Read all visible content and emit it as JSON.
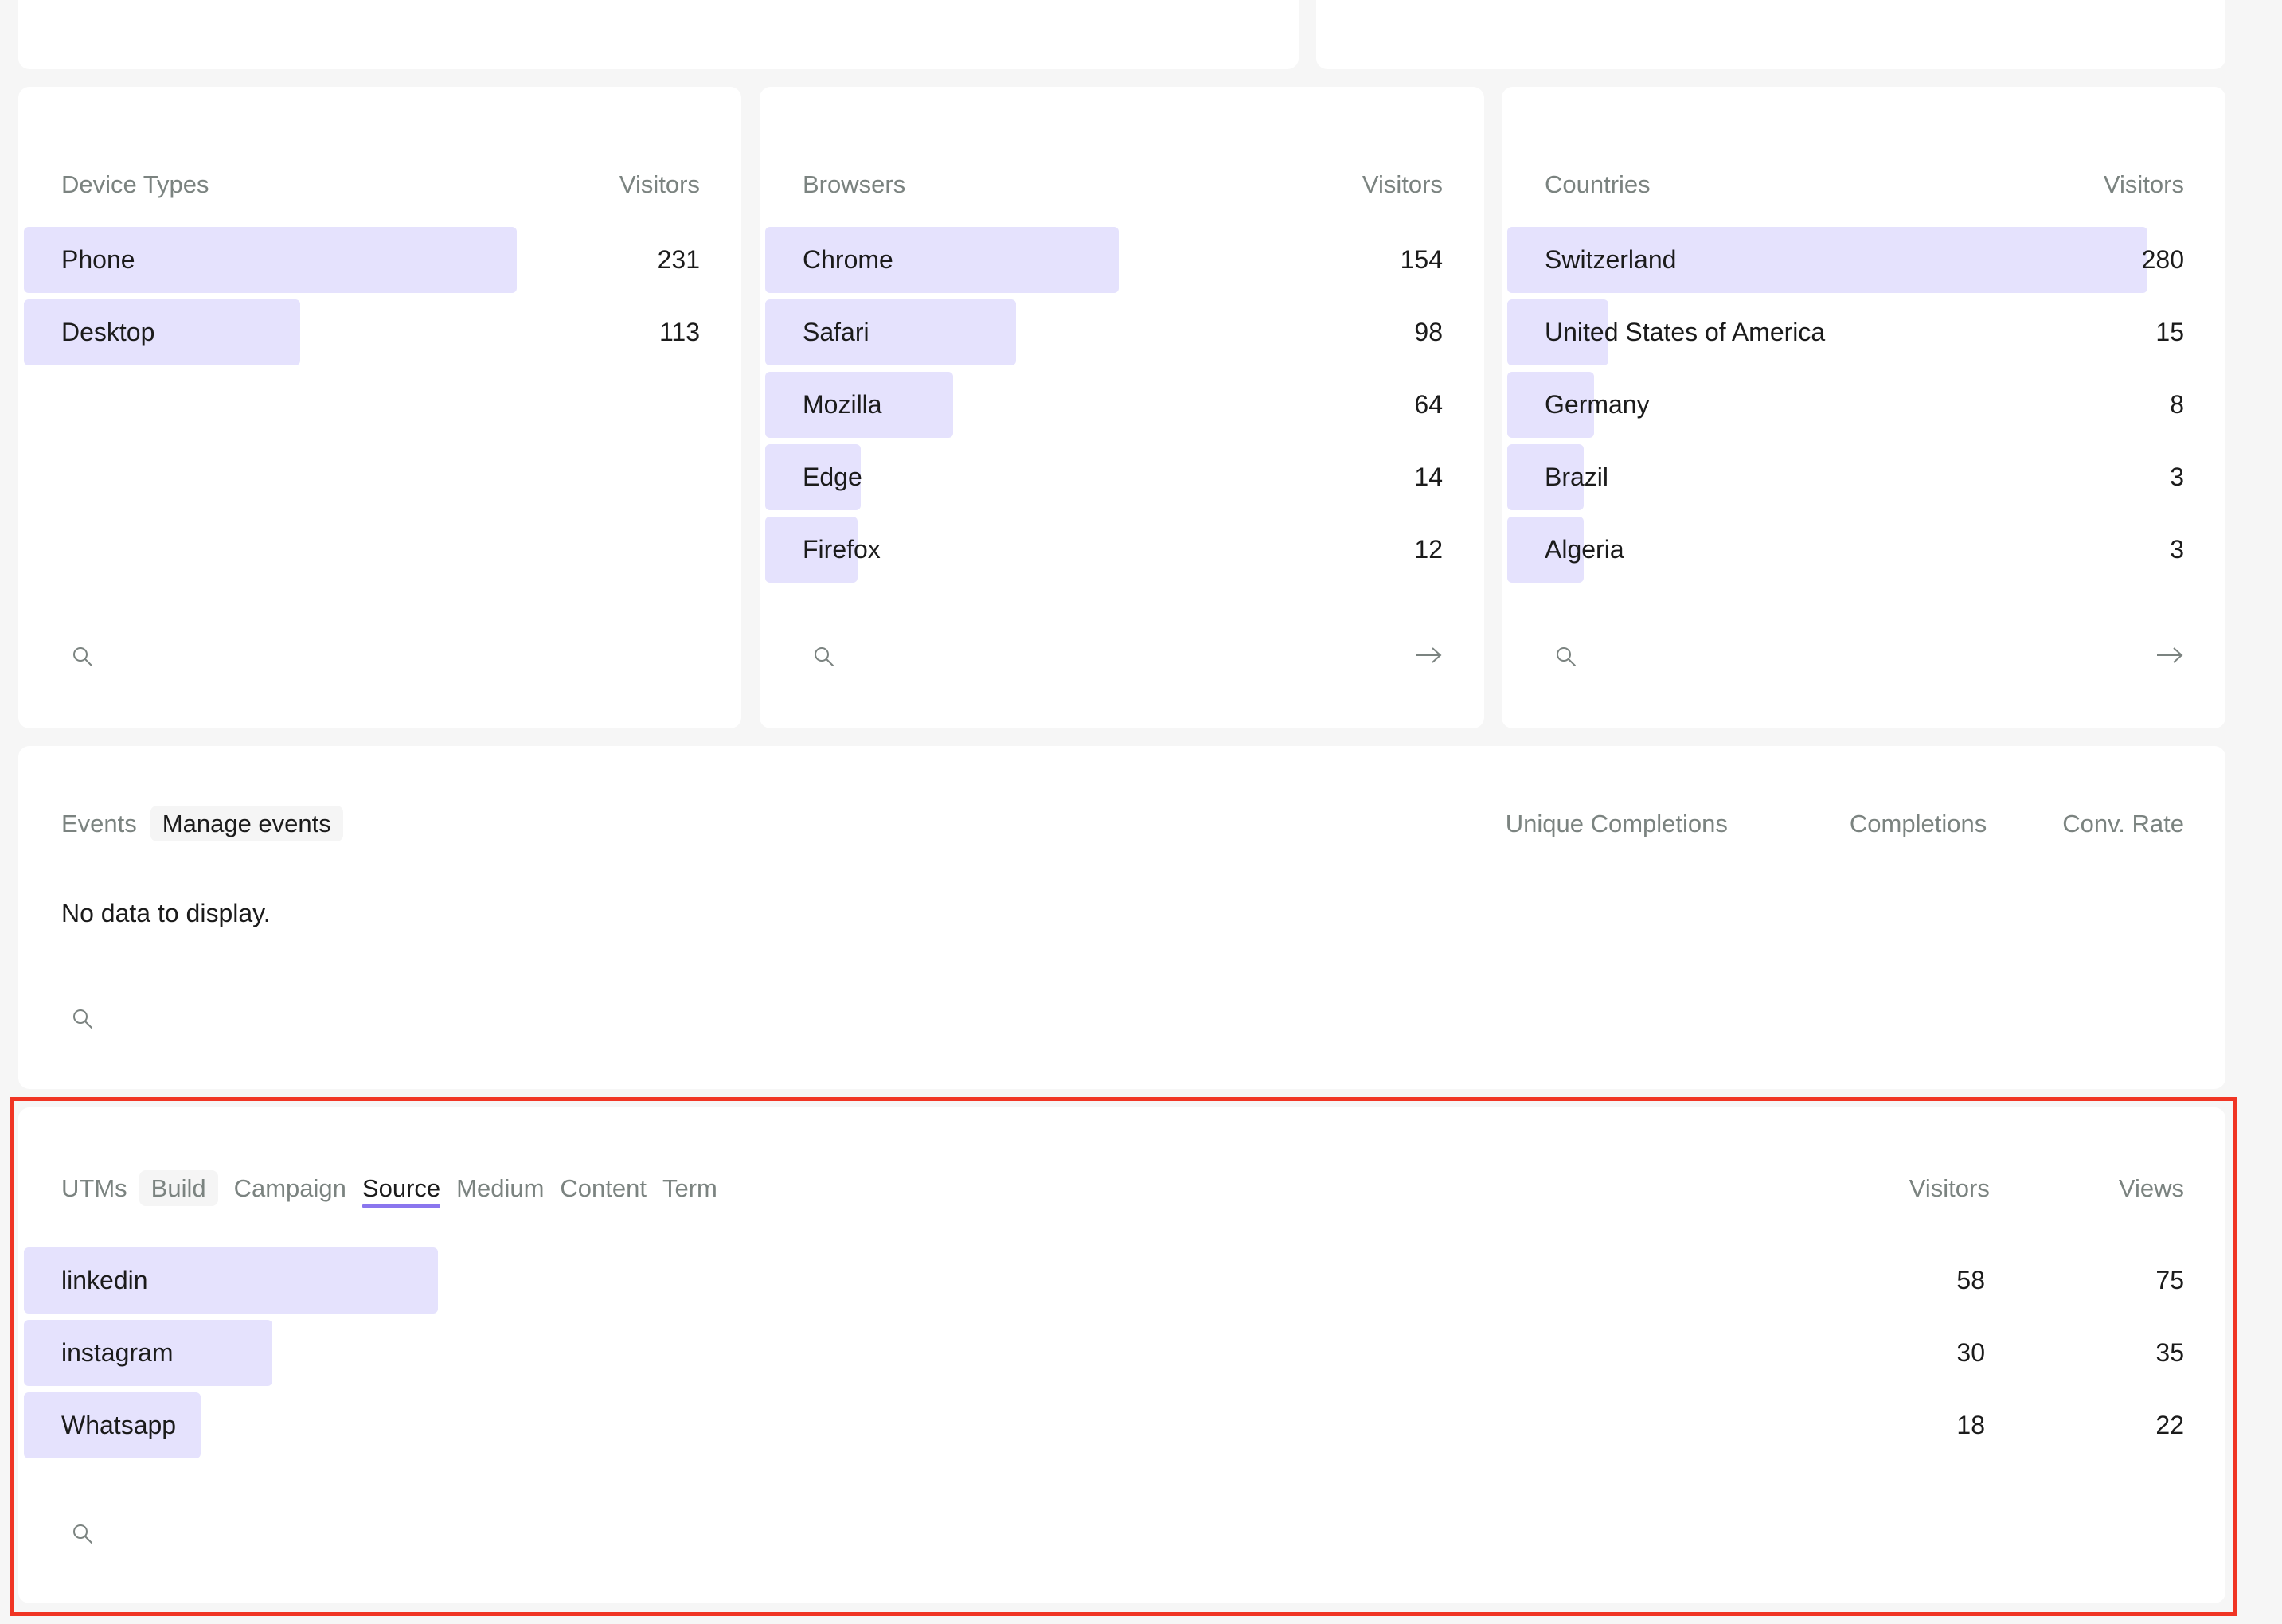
{
  "colors": {
    "background": "#f6f6f6",
    "card": "#ffffff",
    "bar": "#e5e2fd",
    "muted_text": "#7b8380",
    "text": "#1b1b1b",
    "active_tab_underline": "#8a76ee",
    "highlight_box": "#f03524"
  },
  "top_cards": {
    "left": {
      "icons": [
        "search-icon",
        "arrow-right-icon"
      ]
    },
    "right": {
      "icons": [
        "search-icon"
      ]
    }
  },
  "device_types": {
    "title": "Device Types",
    "metric_label": "Visitors",
    "rows": [
      {
        "label": "Phone",
        "value": "231",
        "share": 67.2
      },
      {
        "label": "Desktop",
        "value": "113",
        "share": 32.8
      }
    ],
    "footer_icons": [
      "search-icon"
    ]
  },
  "browsers": {
    "title": "Browsers",
    "metric_label": "Visitors",
    "rows": [
      {
        "label": "Chrome",
        "value": "154",
        "share": 45.0
      },
      {
        "label": "Safari",
        "value": "98",
        "share": 28.7
      },
      {
        "label": "Mozilla",
        "value": "64",
        "share": 18.7
      },
      {
        "label": "Edge",
        "value": "14",
        "share": 4.1
      },
      {
        "label": "Firefox",
        "value": "12",
        "share": 3.5
      }
    ],
    "footer_icons": [
      "search-icon",
      "arrow-right-icon"
    ]
  },
  "countries": {
    "title": "Countries",
    "metric_label": "Visitors",
    "rows": [
      {
        "label": "Switzerland",
        "value": "280",
        "share": 90.6
      },
      {
        "label": "United States of America",
        "value": "15",
        "share": 4.9
      },
      {
        "label": "Germany",
        "value": "8",
        "share": 2.6
      },
      {
        "label": "Brazil",
        "value": "3",
        "share": 1.0
      },
      {
        "label": "Algeria",
        "value": "3",
        "share": 1.0
      }
    ],
    "footer_icons": [
      "search-icon",
      "arrow-right-icon"
    ]
  },
  "events": {
    "title": "Events",
    "manage_label": "Manage events",
    "columns": [
      "Unique Completions",
      "Completions",
      "Conv. Rate"
    ],
    "empty_message": "No data to display.",
    "footer_icons": [
      "search-icon"
    ]
  },
  "utms": {
    "title": "UTMs",
    "tabs": [
      {
        "label": "Build",
        "state": "chip"
      },
      {
        "label": "Campaign",
        "state": "default"
      },
      {
        "label": "Source",
        "state": "active"
      },
      {
        "label": "Medium",
        "state": "default"
      },
      {
        "label": "Content",
        "state": "default"
      },
      {
        "label": "Term",
        "state": "default"
      }
    ],
    "columns": [
      "Visitors",
      "Views"
    ],
    "rows": [
      {
        "label": "linkedin",
        "visitors": "58",
        "views": "75",
        "share": 54.7
      },
      {
        "label": "instagram",
        "visitors": "30",
        "views": "35",
        "share": 28.3
      },
      {
        "label": "Whatsapp",
        "visitors": "18",
        "views": "22",
        "share": 17.0
      }
    ],
    "footer_icons": [
      "search-icon"
    ]
  }
}
